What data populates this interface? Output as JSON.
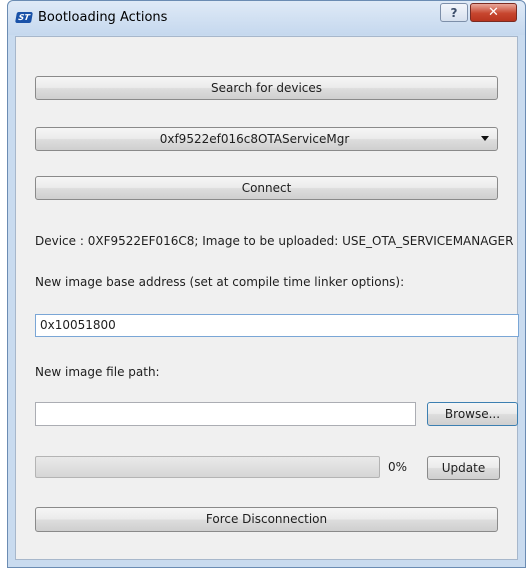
{
  "window": {
    "title": "Bootloading Actions",
    "icon_label": "ST",
    "help_glyph": "?",
    "close_glyph": "✕"
  },
  "actions": {
    "search_label": "Search for devices",
    "device_selected": "0xf9522ef016c8OTAServiceMgr",
    "connect_label": "Connect",
    "device_info": "Device : 0XF9522EF016C8; Image to be uploaded: USE_OTA_SERVICEMANAGER",
    "base_address_label": "New image base address (set at compile time linker options):",
    "base_address_value": "0x10051800",
    "file_path_label": "New image file path:",
    "file_path_value": "",
    "browse_label": "Browse...",
    "progress_percent": 0,
    "progress_text": "0%",
    "update_label": "Update",
    "force_disconnect_label": "Force Disconnection"
  },
  "colors": {
    "progress_fill": "#3ccb3c",
    "close_button": "#c7462f",
    "focus_border": "#7aa6d6"
  }
}
